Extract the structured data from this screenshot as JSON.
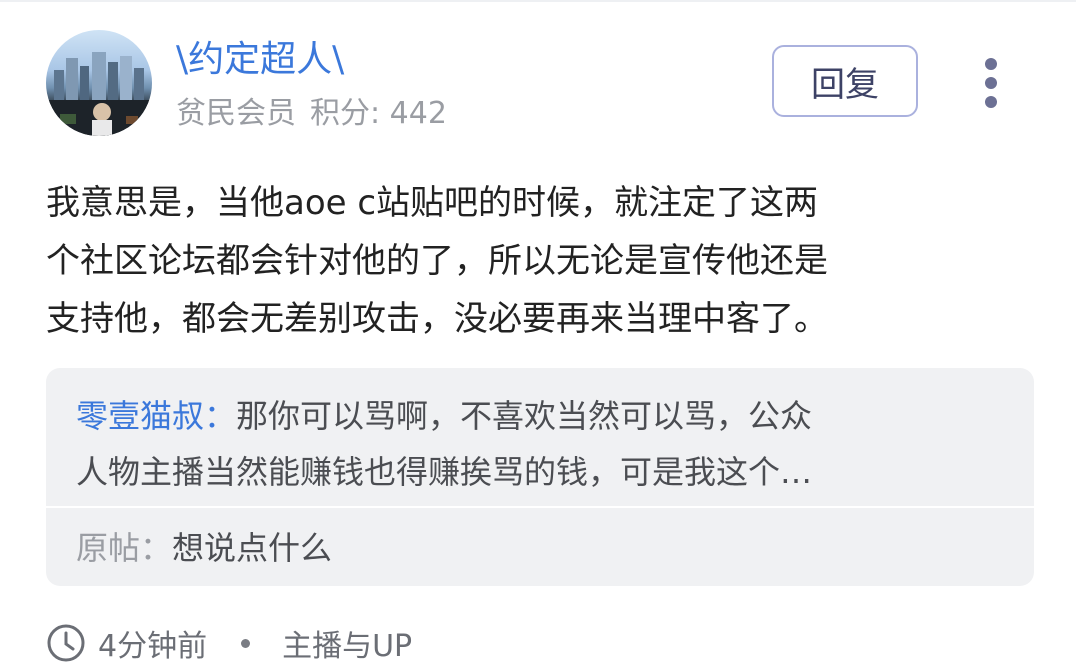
{
  "user": {
    "name": "\\约定超人\\",
    "level": "贫民会员",
    "score_label": "积分: 442"
  },
  "actions": {
    "reply_label": "回复"
  },
  "content": {
    "lines": [
      "我意思是，当他aoe c站贴吧的时候，就注定了这两",
      "个社区论坛都会针对他的了，所以无论是宣传他还是",
      "支持他，都会无差别攻击，没必要再来当理中客了。"
    ]
  },
  "quote": {
    "author": "零壹猫叔：",
    "line1": "那你可以骂啊，不喜欢当然可以骂，公众",
    "line2": "人物主播当然能赚钱也得赚挨骂的钱，可是我这个…",
    "original_label": "原帖：",
    "original_text": "想说点什么"
  },
  "footer": {
    "time": "4分钟前",
    "category": "主播与UP"
  },
  "colors": {
    "accent_blue": "#3b78db",
    "reply_border": "#aab1de",
    "meta_gray": "#9a9da3",
    "quote_bg": "#f0f1f3"
  },
  "icons": {
    "more": "more-vertical-icon",
    "clock": "clock-icon"
  }
}
